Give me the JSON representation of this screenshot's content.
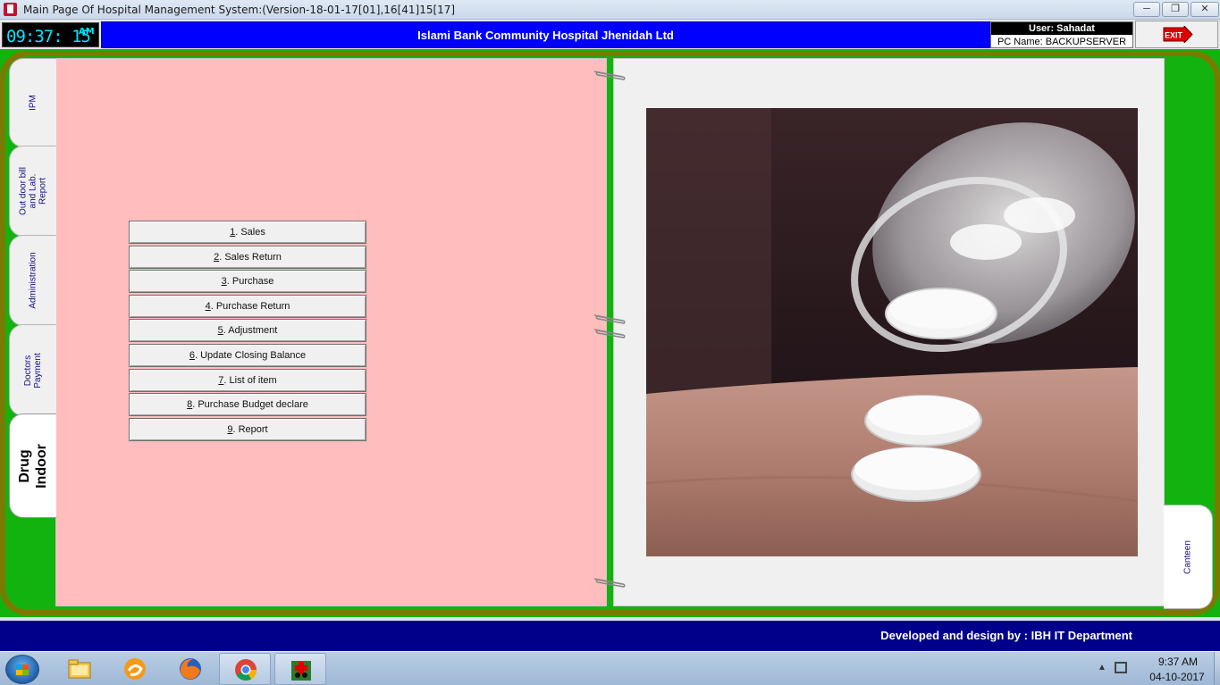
{
  "window": {
    "title": "Main Page Of Hospital Management System:(Version-18-01-17[01],16[41]15[17]"
  },
  "header": {
    "clock_time": "09:37: 15",
    "clock_ampm": "AM",
    "hospital_name": "Islami Bank Community Hospital Jhenidah Ltd",
    "user": "User: Sahadat",
    "pc_name": "PC Name: BACKUPSERVER",
    "exit_label": "EXIT"
  },
  "left_tabs": [
    {
      "label": "IPM"
    },
    {
      "label": "Out door bill\nand Lab.\nReport"
    },
    {
      "label": "Administration"
    },
    {
      "label": "Doctors\nPayment"
    },
    {
      "label": "Drug\nIndoor"
    }
  ],
  "right_tabs": [
    {
      "label": "Canteen"
    }
  ],
  "menu": [
    {
      "num": "1",
      "label": ". Sales"
    },
    {
      "num": "2",
      "label": ". Sales Return"
    },
    {
      "num": "3",
      "label": ". Purchase"
    },
    {
      "num": "4",
      "label": ". Purchase Return"
    },
    {
      "num": "5",
      "label": ". Adjustment"
    },
    {
      "num": "6",
      "label": ". Update Closing Balance"
    },
    {
      "num": "7",
      "label": ". List of item"
    },
    {
      "num": "8",
      "label": ". Purchase Budget declare"
    },
    {
      "num": "9",
      "label": ". Report"
    }
  ],
  "footer": {
    "credit": "Developed and design by : IBH IT Department"
  },
  "taskbar": {
    "time": "9:37 AM",
    "date": "04-10-2017",
    "items": [
      {
        "icon": "file-explorer-icon"
      },
      {
        "icon": "uc-browser-icon"
      },
      {
        "icon": "firefox-icon"
      },
      {
        "icon": "chrome-icon"
      },
      {
        "icon": "hospital-app-icon"
      }
    ]
  },
  "colors": {
    "board_green": "#12b30f",
    "left_page_pink": "#ffbdbd",
    "banner_blue": "#0000ff",
    "footer_navy": "#00008b",
    "clock_cyan": "#00e5ff"
  }
}
